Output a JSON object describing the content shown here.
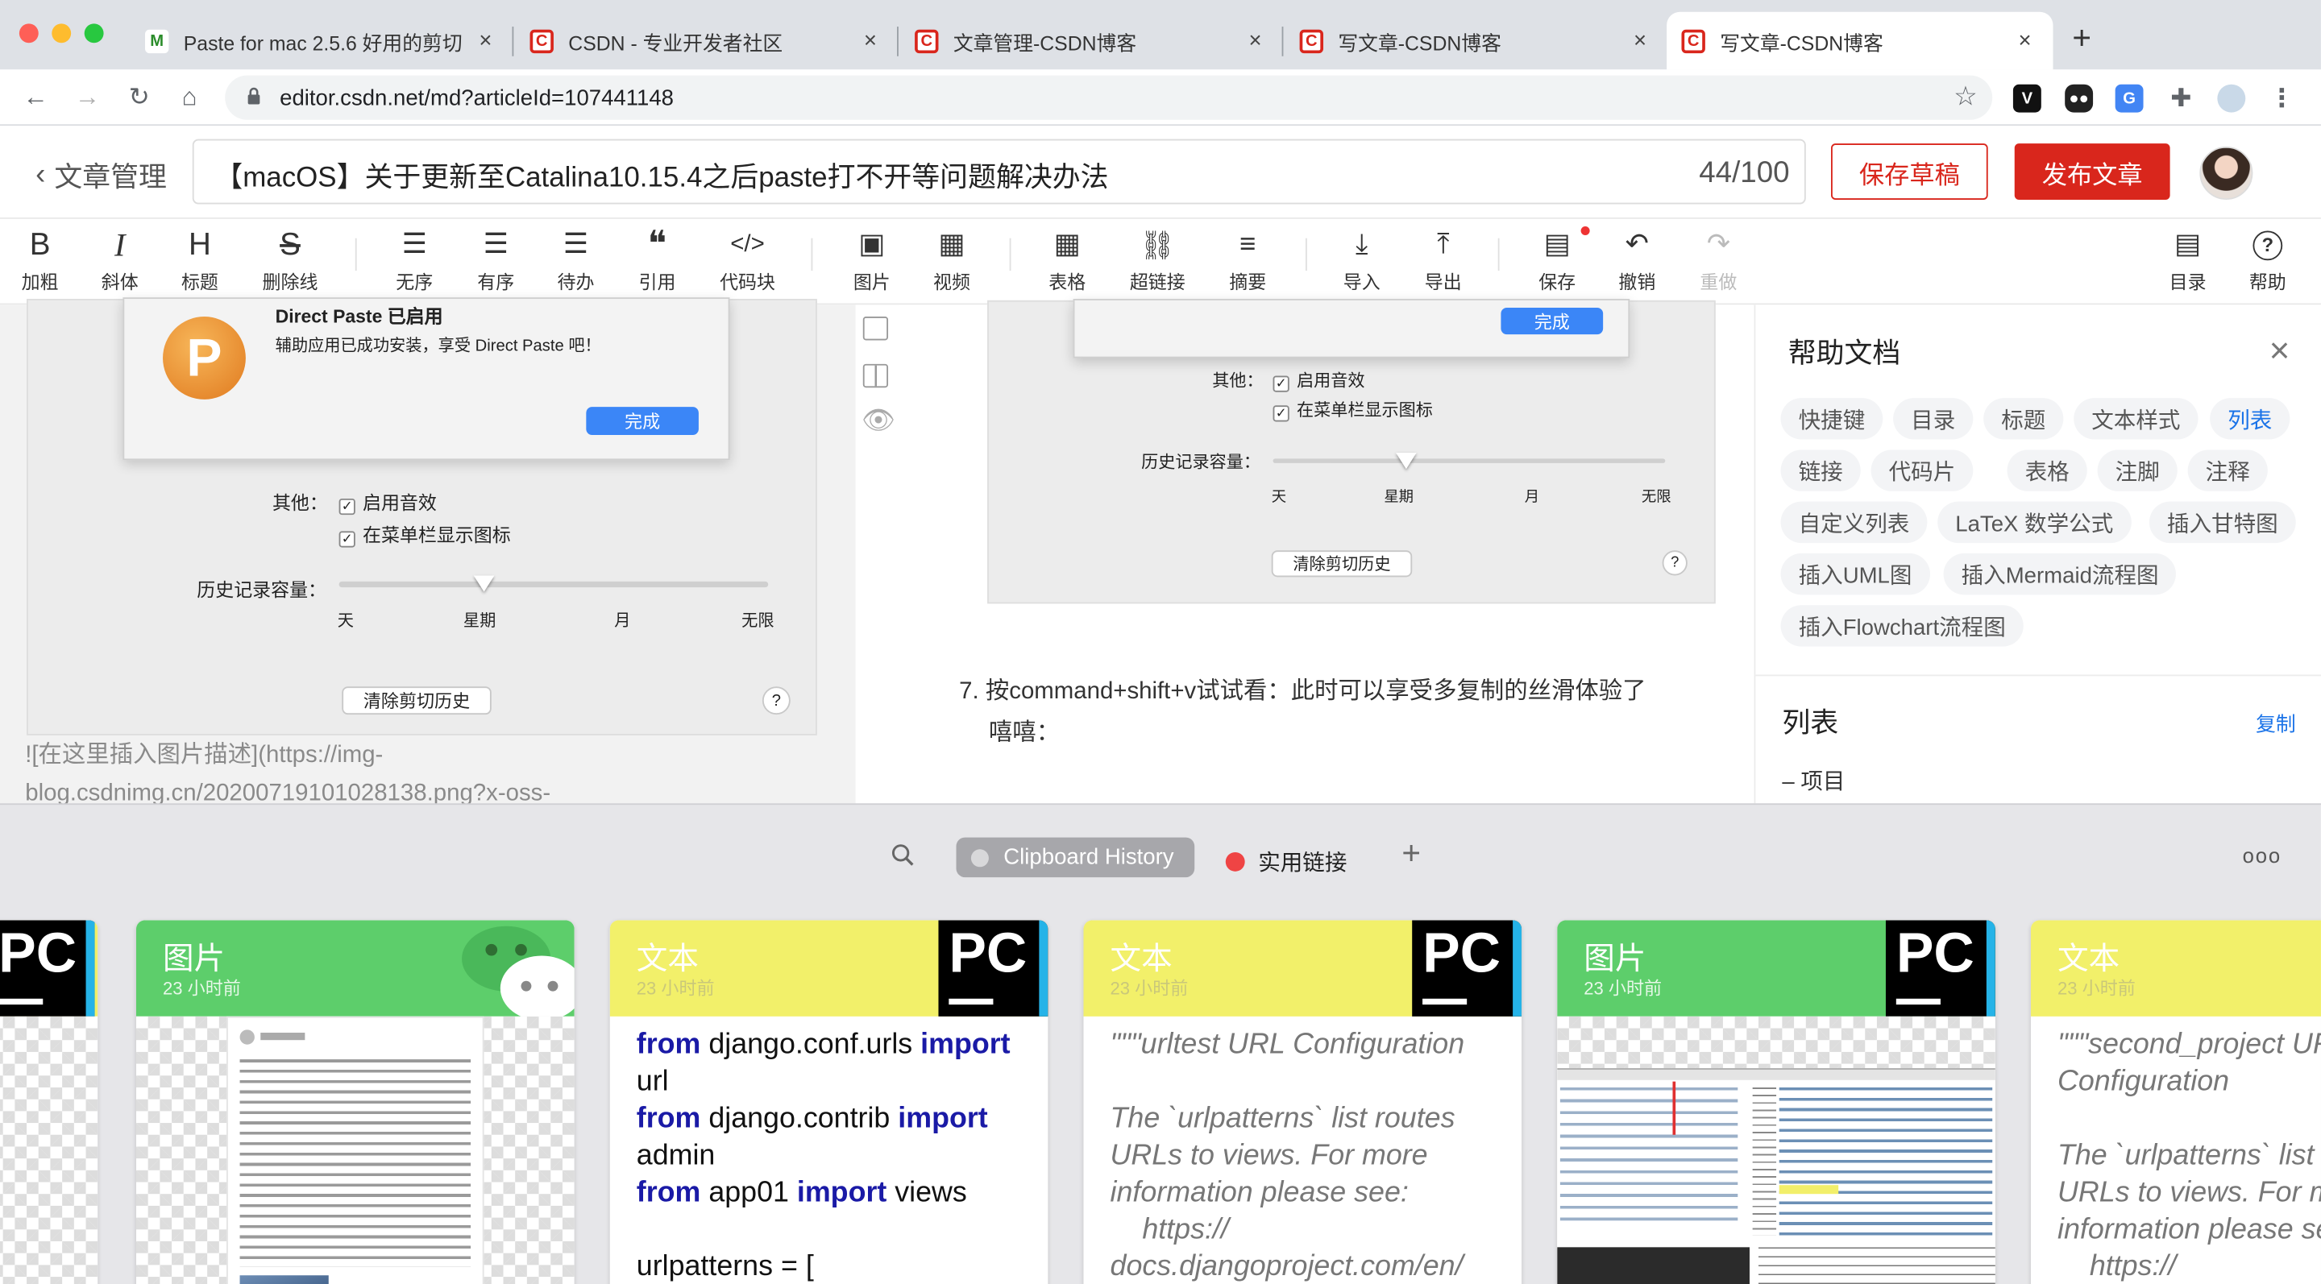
{
  "browser": {
    "tabs": [
      {
        "title": "Paste for mac 2.5.6 好用的剪切",
        "active": false
      },
      {
        "title": "CSDN - 专业开发者社区",
        "active": false
      },
      {
        "title": "文章管理-CSDN博客",
        "active": false
      },
      {
        "title": "写文章-CSDN博客",
        "active": false
      },
      {
        "title": "写文章-CSDN博客",
        "active": true
      }
    ],
    "new_tab": "+",
    "url": "editor.csdn.net/md?articleId=107441148",
    "tab_close": "×"
  },
  "header": {
    "back_label": "文章管理",
    "article_title": "【macOS】关于更新至Catalina10.15.4之后paste打不开等问题解决办法",
    "title_count": "44/100",
    "save_draft": "保存草稿",
    "publish": "发布文章"
  },
  "toolbar": {
    "items": [
      {
        "label": "加粗",
        "icon": "bold-icon",
        "glyph": "B"
      },
      {
        "label": "斜体",
        "icon": "italic-icon",
        "glyph": "I"
      },
      {
        "label": "标题",
        "icon": "heading-icon",
        "glyph": "H"
      },
      {
        "label": "删除线",
        "icon": "strikethrough-icon",
        "glyph": "S"
      },
      {
        "label": "无序",
        "icon": "unordered-list-icon",
        "glyph": "☰"
      },
      {
        "label": "有序",
        "icon": "ordered-list-icon",
        "glyph": "☰"
      },
      {
        "label": "待办",
        "icon": "todo-list-icon",
        "glyph": "☰"
      },
      {
        "label": "引用",
        "icon": "quote-icon",
        "glyph": "❝"
      },
      {
        "label": "代码块",
        "icon": "code-block-icon",
        "glyph": "</>"
      },
      {
        "label": "图片",
        "icon": "image-icon",
        "glyph": "▣"
      },
      {
        "label": "视频",
        "icon": "video-icon",
        "glyph": "▦"
      },
      {
        "label": "表格",
        "icon": "table-icon",
        "glyph": "▦"
      },
      {
        "label": "超链接",
        "icon": "link-icon",
        "glyph": "⛓"
      },
      {
        "label": "摘要",
        "icon": "summary-icon",
        "glyph": "≡"
      },
      {
        "label": "导入",
        "icon": "import-icon",
        "glyph": "⤓"
      },
      {
        "label": "导出",
        "icon": "export-icon",
        "glyph": "⤒"
      },
      {
        "label": "保存",
        "icon": "save-icon",
        "glyph": "▤"
      },
      {
        "label": "撤销",
        "icon": "undo-icon",
        "glyph": "↶"
      },
      {
        "label": "重做",
        "icon": "redo-icon",
        "glyph": "↷"
      },
      {
        "label": "目录",
        "icon": "toc-icon",
        "glyph": "▤"
      },
      {
        "label": "帮助",
        "icon": "help-icon",
        "glyph": "?"
      }
    ]
  },
  "left_shot": {
    "dialog_title": "Direct Paste 已启用",
    "dialog_body": "辅助应用已成功安装，享受 Direct Paste 吧！",
    "done": "完成",
    "other_label": "其他：",
    "opt_sound": "启用音效",
    "opt_menubar": "在菜单栏显示图标",
    "history_label": "历史记录容量：",
    "ticks": [
      "天",
      "星期",
      "月",
      "无限"
    ],
    "clear": "清除剪切历史",
    "help": "?"
  },
  "markdown_source": {
    "line1": "![在这里插入图片描述](https://img-",
    "line2": "blog.csdnimg.cn/20200719101028138.png?x-oss-"
  },
  "preview": {
    "done": "完成",
    "other_label": "其他：",
    "opt_sound": "启用音效",
    "opt_menubar": "在菜单栏显示图标",
    "history_label": "历史记录容量：",
    "ticks": [
      "天",
      "星期",
      "月",
      "无限"
    ],
    "clear": "清除剪切历史",
    "help": "?",
    "step_number": "7.",
    "step_line1": "按command+shift+v试试看：此时可以享受多复制的丝滑体验了",
    "step_line2": "嘻嘻："
  },
  "help_panel": {
    "title": "帮助文档",
    "close": "×",
    "tags": [
      "快捷键",
      "目录",
      "标题",
      "文本样式",
      "列表",
      "链接",
      "代码片",
      "表格",
      "注脚",
      "注释",
      "自定义列表",
      "LaTeX 数学公式",
      "插入甘特图",
      "插入UML图",
      "插入Mermaid流程图",
      "插入Flowchart流程图"
    ],
    "active_tag": "列表",
    "section_title": "列表",
    "copy": "复制",
    "item": "– 项目"
  },
  "paste_app": {
    "search_icon": "search-icon",
    "pinboard_active": "Clipboard History",
    "pinboard_other": "实用链接",
    "add": "+",
    "more": "ooo",
    "cards": [
      {
        "type": "图片",
        "time": "23 小时前",
        "app": "WeChat",
        "color": "#5dce6b"
      },
      {
        "type": "文本",
        "time": "23 小时前",
        "app": "PyCharm",
        "color": "#f2f06a"
      },
      {
        "type": "文本",
        "time": "23 小时前",
        "app": "PyCharm",
        "color": "#f2f06a"
      },
      {
        "type": "图片",
        "time": "23 小时前",
        "app": "PyCharm",
        "color": "#5dce6b"
      },
      {
        "type": "文本",
        "time": "23 小时前",
        "app": "PyCharm",
        "color": "#f2f06a"
      }
    ],
    "code_card": {
      "l1a": "from",
      "l1b": " django.conf.urls ",
      "l1c": "import",
      "l2": "url",
      "l3a": "from",
      "l3b": " django.contrib ",
      "l3c": "import",
      "l4": "admin",
      "l5a": "from",
      "l5b": " app01 ",
      "l5c": "import",
      "l5d": " views",
      "l6": "",
      "l7": "urlpatterns = ["
    },
    "doc_card": {
      "text": "\"\"\"urltest URL Configuration\n\nThe `urlpatterns` list routes\nURLs to views. For more\ninformation please see:\n    https://\ndocs.djangoproject.com/en/"
    },
    "doc_card2": {
      "text": "\"\"\"second_project URL\nConfiguration\n\nThe `urlpatterns` list routes\nURLs to views. For more\ninformation please see:\n    https://"
    },
    "pc_label": "PC"
  },
  "colors": {
    "csdn_red": "#d9261c",
    "link_blue": "#1a73e8",
    "paste_green": "#5dce6b",
    "paste_yellow": "#f2f06a"
  }
}
